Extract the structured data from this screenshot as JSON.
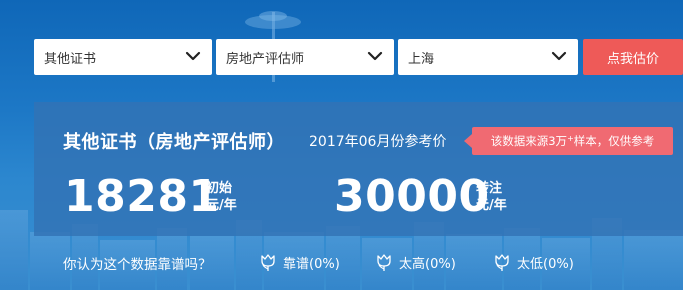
{
  "filters": {
    "certificate": "其他证书",
    "position": "房地产评估师",
    "city": "上海"
  },
  "estimate_button": "点我估价",
  "result": {
    "title": "其他证书（房地产评估师）",
    "reference": "2017年06月份参考价",
    "source_note_prefix": "该数据来源3万",
    "source_note_sup": "+",
    "source_note_suffix": "样本，仅供参考",
    "initial_salary": "18281",
    "initial_label": "初始",
    "initial_unit": "元/年",
    "senior_salary": "30000",
    "senior_label": "转注",
    "senior_unit": "元/年"
  },
  "feedback": {
    "question": "你认为这个数据靠谱吗？",
    "options": [
      {
        "label": "靠谱(0%)",
        "icon": "tulip-icon"
      },
      {
        "label": "太高(0%)",
        "icon": "tulip-icon"
      },
      {
        "label": "太低(0%)",
        "icon": "tulip-icon"
      }
    ]
  },
  "colors": {
    "accent": "#ee5a58",
    "badge": "#f06a72",
    "panel": "#3273b4"
  }
}
